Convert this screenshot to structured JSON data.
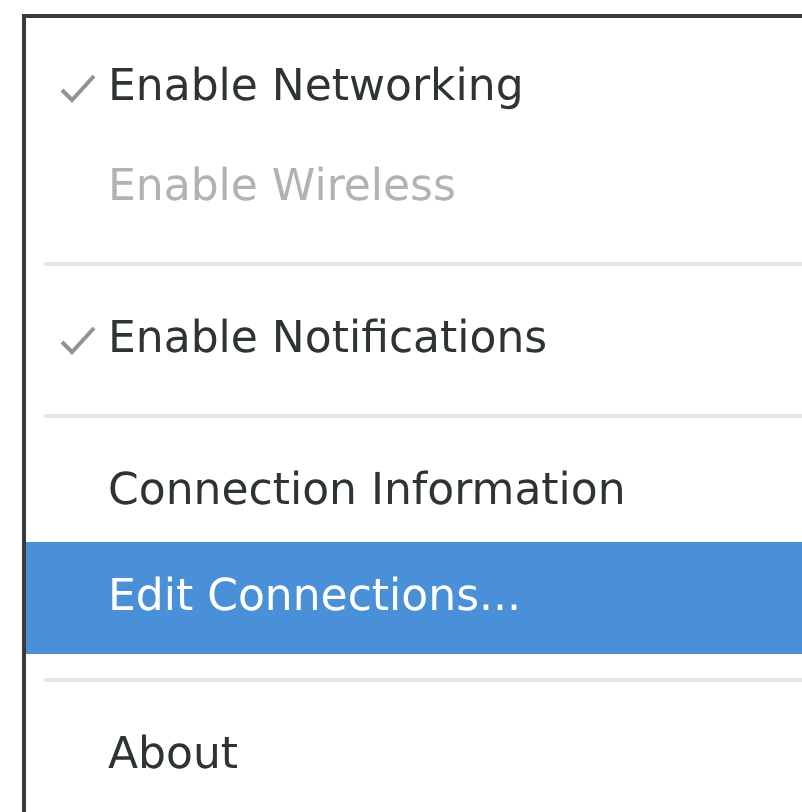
{
  "menu": {
    "items": [
      {
        "kind": "check",
        "label": "Enable Networking",
        "checked": true,
        "disabled": false,
        "selected": false
      },
      {
        "kind": "check",
        "label": "Enable Wireless",
        "checked": false,
        "disabled": true,
        "selected": false
      },
      {
        "kind": "separator"
      },
      {
        "kind": "check",
        "label": "Enable Notifications",
        "checked": true,
        "disabled": false,
        "selected": false
      },
      {
        "kind": "separator"
      },
      {
        "kind": "item",
        "label": "Connection Information",
        "disabled": false,
        "selected": false
      },
      {
        "kind": "item",
        "label": "Edit Connections...",
        "disabled": false,
        "selected": true
      },
      {
        "kind": "separator"
      },
      {
        "kind": "item",
        "label": "About",
        "disabled": false,
        "selected": false
      }
    ]
  }
}
